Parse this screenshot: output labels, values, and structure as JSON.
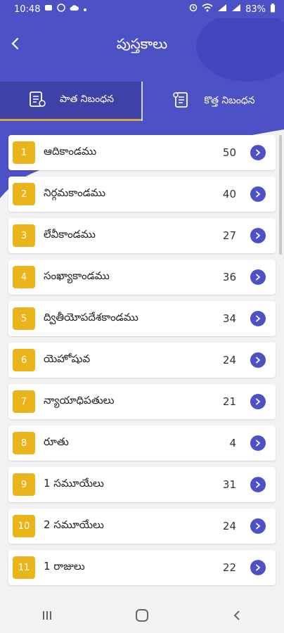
{
  "status": {
    "time": "10:48",
    "battery": "83%",
    "icons_left": [
      "message-icon",
      "whatsapp-icon",
      "cloud-icon",
      "dot-icon"
    ],
    "icons_right": [
      "alarm-icon",
      "wifi-icon",
      "signal-icon",
      "signal-icon",
      "battery-icon"
    ]
  },
  "header": {
    "title": "పుస్తకాలు"
  },
  "tabs": [
    {
      "label": "పాత నిబంధన",
      "icon": "old-book-icon"
    },
    {
      "label": "కొత్త నిబంధన",
      "icon": "new-book-icon"
    }
  ],
  "books": [
    {
      "n": "1",
      "name": "ఆదికాండము",
      "count": "50"
    },
    {
      "n": "2",
      "name": "నిర్గమకాండము",
      "count": "40"
    },
    {
      "n": "3",
      "name": "లేవీకాండము",
      "count": "27"
    },
    {
      "n": "4",
      "name": "సంఖ్యాకాండము",
      "count": "36"
    },
    {
      "n": "5",
      "name": "ద్వితీయోపదేశకాండము",
      "count": "34"
    },
    {
      "n": "6",
      "name": "యెహోషువ",
      "count": "24"
    },
    {
      "n": "7",
      "name": "న్యాయాధిపతులు",
      "count": "21"
    },
    {
      "n": "8",
      "name": "రూతు",
      "count": "4"
    },
    {
      "n": "9",
      "name": "1 సమూయేలు",
      "count": "31"
    },
    {
      "n": "10",
      "name": "2 సమూయేలు",
      "count": "24"
    },
    {
      "n": "11",
      "name": "1 రాజులు",
      "count": "22"
    }
  ],
  "colors": {
    "primary": "#4c51c6",
    "badge": "#ebb41b",
    "active_tab_underline": "#d3a642"
  },
  "navbar": [
    "recent-apps-icon",
    "home-icon",
    "back-nav-icon"
  ]
}
